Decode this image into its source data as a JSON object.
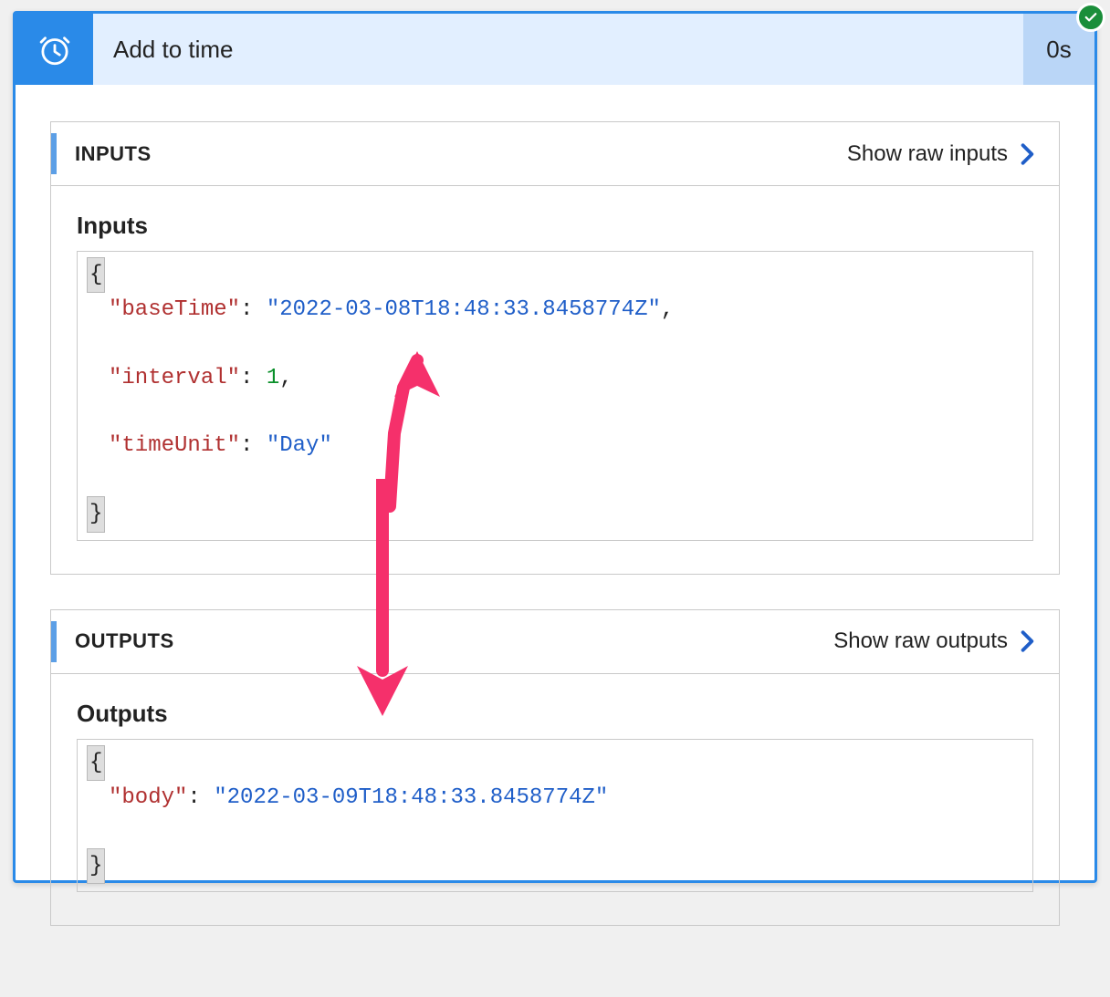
{
  "header": {
    "title": "Add to time",
    "duration": "0s"
  },
  "inputs_panel": {
    "label": "INPUTS",
    "show_raw": "Show raw inputs",
    "subtitle": "Inputs",
    "json": {
      "k1": "baseTime",
      "v1": "2022-03-08T18:48:33.8458774Z",
      "k2": "interval",
      "v2": "1",
      "k3": "timeUnit",
      "v3": "Day"
    }
  },
  "outputs_panel": {
    "label": "OUTPUTS",
    "show_raw": "Show raw outputs",
    "subtitle": "Outputs",
    "json": {
      "k1": "body",
      "v1": "2022-03-09T18:48:33.8458774Z"
    }
  }
}
